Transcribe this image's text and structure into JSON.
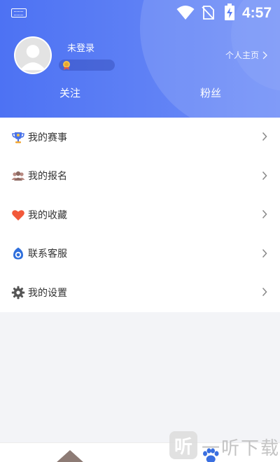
{
  "status_bar": {
    "time": "4:57",
    "icons": [
      "keyboard-icon",
      "wifi-icon",
      "no-sim-icon",
      "battery-charging-icon"
    ]
  },
  "profile": {
    "username": "未登录",
    "homepage_link": "个人主页",
    "stats": {
      "follow_label": "关注",
      "fans_label": "粉丝"
    }
  },
  "menu": {
    "items": [
      {
        "label": "我的赛事",
        "icon": "trophy-icon"
      },
      {
        "label": "我的报名",
        "icon": "group-icon"
      },
      {
        "label": "我的收藏",
        "icon": "heart-icon"
      },
      {
        "label": "联系客服",
        "icon": "headset-icon"
      },
      {
        "label": "我的设置",
        "icon": "gear-icon"
      }
    ]
  },
  "watermark": {
    "logo_char": "听",
    "text": "一听下载"
  },
  "colors": {
    "header_start": "#4d72f3",
    "header_end": "#6f8ef7",
    "heart": "#f2593a",
    "trophy": "#4a73e8",
    "headset": "#2f6fdc"
  }
}
